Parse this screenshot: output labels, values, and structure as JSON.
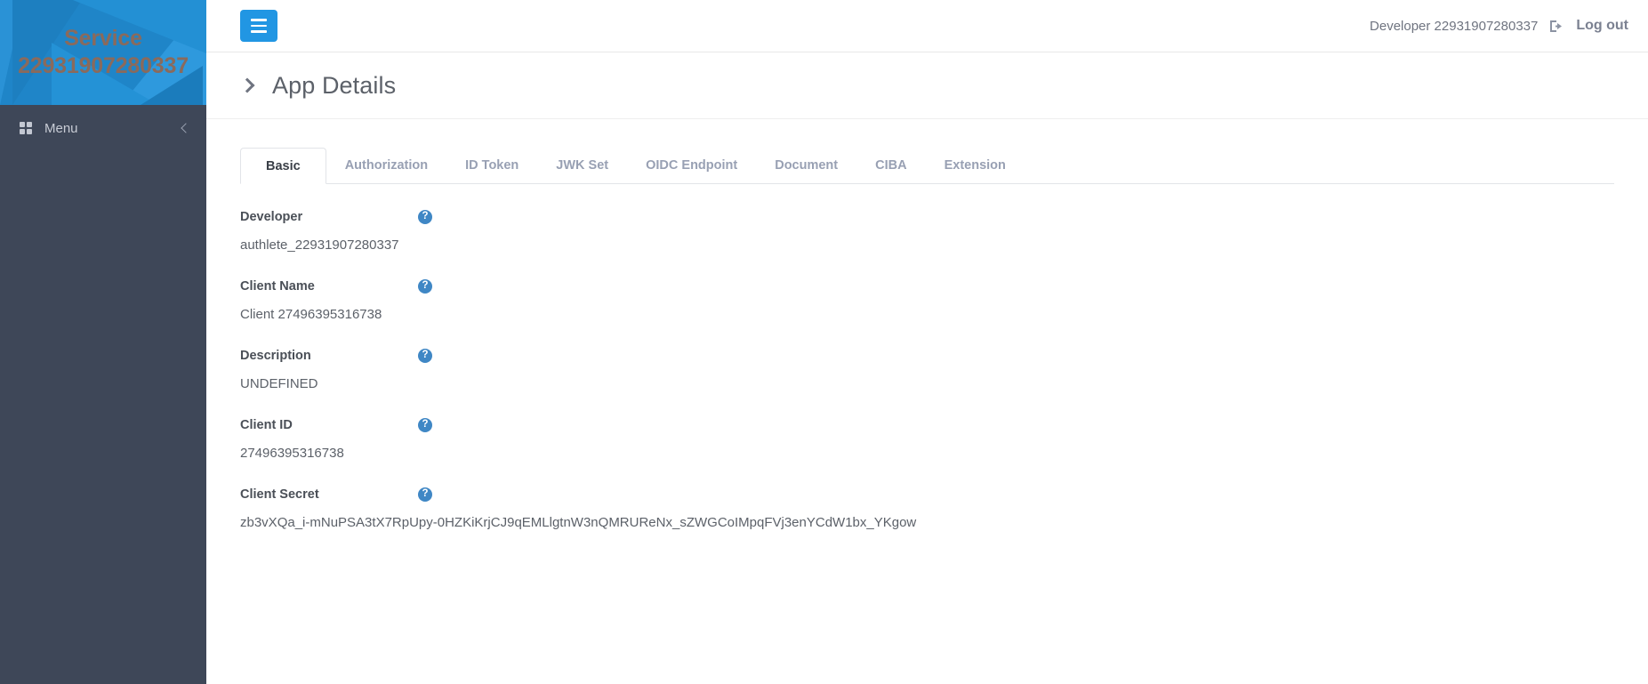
{
  "sidebar": {
    "service_title": "Service",
    "service_number": "22931907280337",
    "menu_label": "Menu",
    "grid_icon": "grid-icon",
    "collapse_icon": "chevron-left-icon"
  },
  "topbar": {
    "hamburger_icon": "hamburger-icon",
    "user_name": "Developer 22931907280337",
    "logout_icon": "sign-out-icon",
    "logout_label": "Log out"
  },
  "page": {
    "expand_icon": "chevron-right-icon",
    "title": "App Details"
  },
  "tabs": [
    {
      "label": "Basic",
      "active": true
    },
    {
      "label": "Authorization",
      "active": false
    },
    {
      "label": "ID Token",
      "active": false
    },
    {
      "label": "JWK Set",
      "active": false
    },
    {
      "label": "OIDC Endpoint",
      "active": false
    },
    {
      "label": "Document",
      "active": false
    },
    {
      "label": "CIBA",
      "active": false
    },
    {
      "label": "Extension",
      "active": false
    }
  ],
  "fields": [
    {
      "label": "Developer",
      "value": "authlete_22931907280337",
      "help": "?"
    },
    {
      "label": "Client Name",
      "value": "Client 27496395316738",
      "help": "?"
    },
    {
      "label": "Description",
      "value": "UNDEFINED",
      "help": "?"
    },
    {
      "label": "Client ID",
      "value": "27496395316738",
      "help": "?"
    },
    {
      "label": "Client Secret",
      "value": "zb3vXQa_i-mNuPSA3tX7RpUpy-0HZKiKrjCJ9qEMLlgtnW3nQMRUReNx_sZWGCoIMpqFVj3enYCdW1bx_YKgow",
      "help": "?"
    }
  ],
  "colors": {
    "brand_blue": "#2196e3",
    "sidebar_dark": "#3e4758",
    "banner_blue": "#1f85c8",
    "help_blue": "#3f87c5",
    "tab_inactive": "#98a0b3"
  }
}
